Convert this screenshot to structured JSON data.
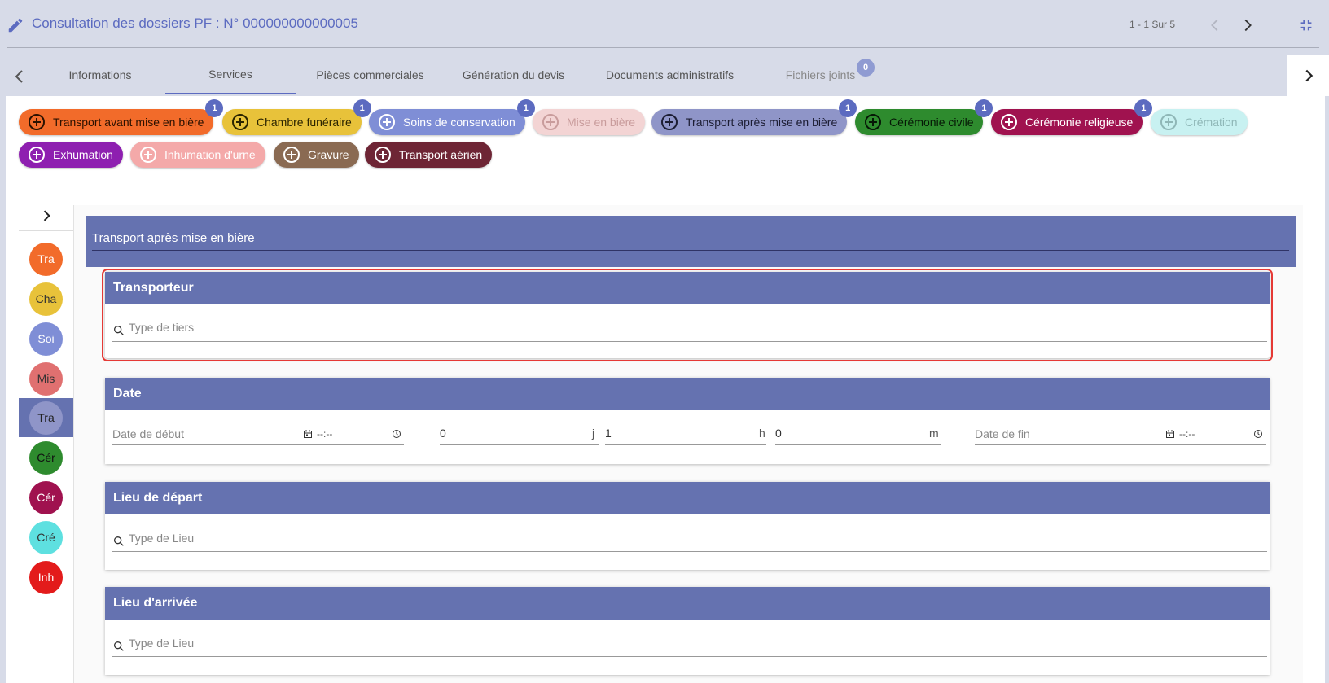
{
  "header": {
    "title": "Consultation des dossiers PF : N° 000000000000005",
    "pager": "1 - 1 Sur 5"
  },
  "tabs": [
    {
      "label": "Informations"
    },
    {
      "label": "Services"
    },
    {
      "label": "Pièces commerciales"
    },
    {
      "label": "Génération du devis"
    },
    {
      "label": "Documents administratifs"
    },
    {
      "label": "Fichiers joints",
      "badge": "0"
    }
  ],
  "chips": [
    {
      "label": "Transport avant mise en bière",
      "badge": "1",
      "bg": "#f26b2a",
      "fg": "#2b1100"
    },
    {
      "label": "Chambre funéraire",
      "badge": "1",
      "bg": "#e8c23a",
      "fg": "#2b2400"
    },
    {
      "label": "Soins de conservation",
      "badge": "1",
      "bg": "#7f8ed6",
      "fg": "#ffffff"
    },
    {
      "label": "Mise en bière",
      "badge": "",
      "bg": "#f3d4d4",
      "fg": "#c99c9c"
    },
    {
      "label": "Transport après mise en bière",
      "badge": "1",
      "bg": "#8f95c8",
      "fg": "#1c1d33"
    },
    {
      "label": "Cérémonie civile",
      "badge": "1",
      "bg": "#2e8b2e",
      "fg": "#061806"
    },
    {
      "label": "Cérémonie religieuse",
      "badge": "1",
      "bg": "#a0124f",
      "fg": "#ffffff"
    },
    {
      "label": "Crémation",
      "badge": "",
      "bg": "#c8f1f1",
      "fg": "#8fb7b7"
    },
    {
      "label": "Exhumation",
      "badge": "",
      "bg": "#8e1fb0",
      "fg": "#ffffff"
    },
    {
      "label": "Inhumation d'urne",
      "badge": "",
      "bg": "#f4a9a9",
      "fg": "#ffffff"
    },
    {
      "label": "Gravure",
      "badge": "",
      "bg": "#8a6a52",
      "fg": "#ffffff"
    },
    {
      "label": "Transport aérien",
      "badge": "",
      "bg": "#6e2535",
      "fg": "#ffffff"
    }
  ],
  "rail": [
    {
      "label": "Tra",
      "bg": "#f26b2a",
      "fg": "#ffffff"
    },
    {
      "label": "Cha",
      "bg": "#e8c23a",
      "fg": "#333333"
    },
    {
      "label": "Soi",
      "bg": "#7f8ed6",
      "fg": "#ffffff"
    },
    {
      "label": "Mis",
      "bg": "#e07070",
      "fg": "#333333"
    },
    {
      "label": "Tra",
      "bg": "#8f95c8",
      "fg": "#222222"
    },
    {
      "label": "Cér",
      "bg": "#2e8b2e",
      "fg": "#111111"
    },
    {
      "label": "Cér",
      "bg": "#a0124f",
      "fg": "#ffffff"
    },
    {
      "label": "Cré",
      "bg": "#5ee0e0",
      "fg": "#333333"
    },
    {
      "label": "Inh",
      "bg": "#e31b1b",
      "fg": "#ffffff"
    }
  ],
  "section_title": "Transport après mise en bière",
  "transporteur": {
    "title": "Transporteur",
    "placeholder": "Type de tiers"
  },
  "date": {
    "title": "Date",
    "start_label": "Date de début",
    "start_time": "--:--",
    "days": "0",
    "days_unit": "j",
    "hours": "1",
    "hours_unit": "h",
    "minutes": "0",
    "minutes_unit": "m",
    "end_label": "Date de fin",
    "end_time": "--:--"
  },
  "lieu_depart": {
    "title": "Lieu de départ",
    "placeholder": "Type de Lieu"
  },
  "lieu_arrivee": {
    "title": "Lieu d'arrivée",
    "placeholder": "Type de Lieu"
  }
}
